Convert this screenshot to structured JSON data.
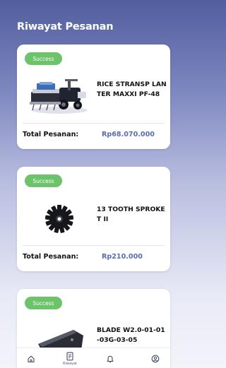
{
  "header": {
    "title": "Riwayat Pesanan"
  },
  "orders": [
    {
      "status": "Success",
      "product_name": "RICE STRANSP LANTER MAXXI PF-48",
      "total_label": "Total Pesanan:",
      "total_value": "Rp68.070.000",
      "image": "rice-transplanter-image"
    },
    {
      "status": "Success",
      "product_name": "13 TOOTH SPROKET II",
      "total_label": "Total Pesanan:",
      "total_value": "Rp210.000",
      "image": "sprocket-gear-image"
    },
    {
      "status": "Success",
      "product_name": "BLADE W2.0-01-01-03G-03-05",
      "image": "blade-part-image"
    }
  ],
  "bottom_nav": {
    "items": [
      {
        "id": "home",
        "icon": "home-icon",
        "label": ""
      },
      {
        "id": "riwayat",
        "icon": "receipt-icon",
        "label": "Riwayat"
      },
      {
        "id": "notifications",
        "icon": "bell-icon",
        "label": ""
      },
      {
        "id": "profile",
        "icon": "user-circle-icon",
        "label": ""
      }
    ]
  },
  "colors": {
    "header_bg": "#525e9e",
    "badge_success": "#6cc36a",
    "price": "#5a6cb3",
    "card_bg": "#ffffff"
  }
}
